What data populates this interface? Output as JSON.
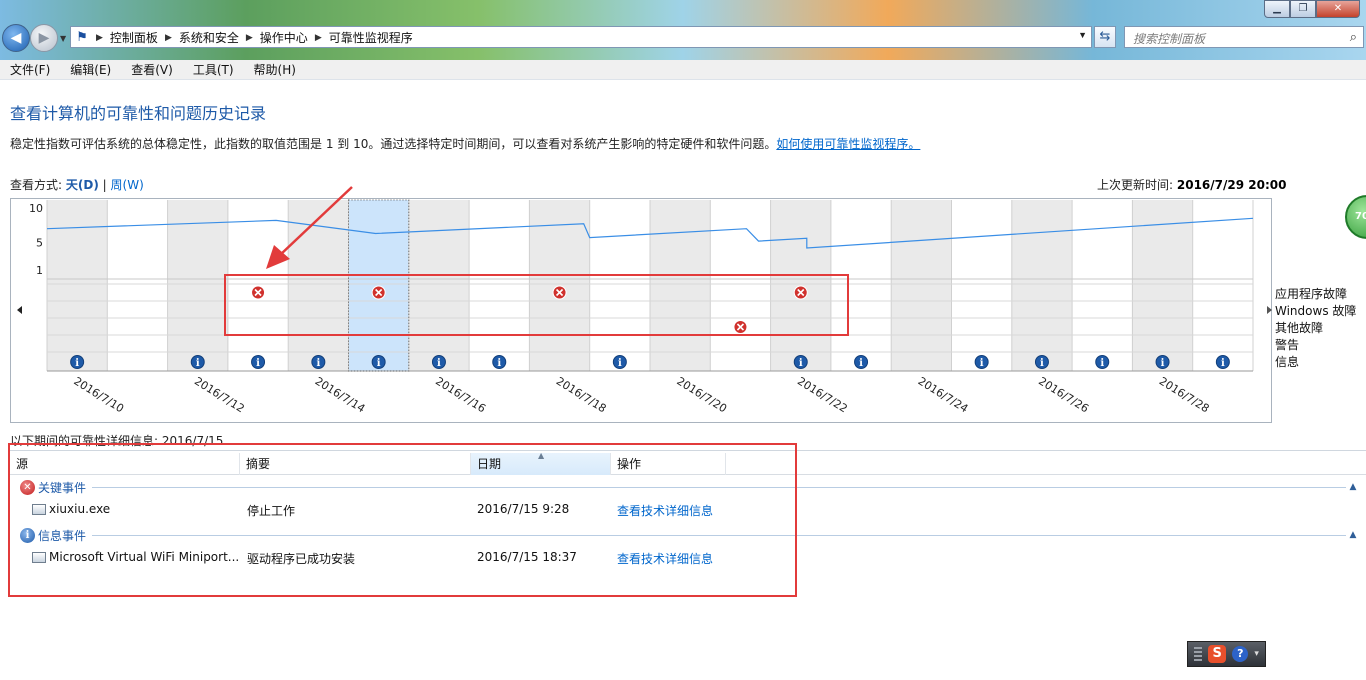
{
  "window": {
    "minimize": "▁",
    "restore": "❐",
    "close": "✕"
  },
  "breadcrumb": [
    "控制面板",
    "系统和安全",
    "操作中心",
    "可靠性监视程序"
  ],
  "search": {
    "placeholder": "搜索控制面板"
  },
  "menu": [
    "文件(F)",
    "编辑(E)",
    "查看(V)",
    "工具(T)",
    "帮助(H)"
  ],
  "page": {
    "title": "查看计算机的可靠性和问题历史记录",
    "description": "稳定性指数可评估系统的总体稳定性，此指数的取值范围是 1 到 10。通过选择特定时间期间，可以查看对系统产生影响的特定硬件和软件问题。",
    "help_link": "如何使用可靠性监视程序。",
    "view_label": "查看方式:",
    "view_day": "天(D)",
    "view_sep": "|",
    "view_week": "周(W)",
    "last_update_label": "上次更新时间:",
    "last_update_value": "2016/7/29 20:00",
    "score_badge": "70"
  },
  "chart_data": {
    "type": "line",
    "y_ticks": [
      "10",
      "5",
      "1"
    ],
    "ylim": [
      1,
      10
    ],
    "columns": [
      "2016/7/10",
      "2016/7/11",
      "2016/7/12",
      "2016/7/13",
      "2016/7/14",
      "2016/7/15",
      "2016/7/16",
      "2016/7/17",
      "2016/7/18",
      "2016/7/19",
      "2016/7/20",
      "2016/7/21",
      "2016/7/22",
      "2016/7/23",
      "2016/7/24",
      "2016/7/25",
      "2016/7/26",
      "2016/7/27",
      "2016/7/28",
      "2016/7/29"
    ],
    "x_tick_labels": [
      "2016/7/10",
      "2016/7/12",
      "2016/7/14",
      "2016/7/16",
      "2016/7/18",
      "2016/7/20",
      "2016/7/22",
      "2016/7/24",
      "2016/7/26",
      "2016/7/28"
    ],
    "selected_column": "2016/7/15",
    "stability_index": [
      {
        "x": 0,
        "y": 7.0
      },
      {
        "x": 3.8,
        "y": 8.2
      },
      {
        "x": 5.45,
        "y": 6.3
      },
      {
        "x": 8.9,
        "y": 7.7
      },
      {
        "x": 9.0,
        "y": 5.7
      },
      {
        "x": 11.6,
        "y": 7.0
      },
      {
        "x": 11.8,
        "y": 5.2
      },
      {
        "x": 12.6,
        "y": 5.6
      },
      {
        "x": 12.6,
        "y": 4.2
      },
      {
        "x": 20,
        "y": 8.5
      }
    ],
    "categories": [
      "应用程序故障",
      "Windows 故障",
      "其他故障",
      "警告",
      "信息"
    ],
    "events": {
      "应用程序故障": [
        "2016/7/13",
        "2016/7/15",
        "2016/7/18",
        "2016/7/22"
      ],
      "Windows 故障": [],
      "其他故障": [
        "2016/7/21"
      ],
      "警告": [],
      "信息": [
        "2016/7/10",
        "2016/7/12",
        "2016/7/13",
        "2016/7/14",
        "2016/7/15",
        "2016/7/16",
        "2016/7/17",
        "2016/7/19",
        "2016/7/22",
        "2016/7/23",
        "2016/7/25",
        "2016/7/26",
        "2016/7/27",
        "2016/7/28",
        "2016/7/29"
      ]
    },
    "colors": {
      "line": "#3a8ee6",
      "selected": "#cce4fb",
      "shaded": "#eaeaea",
      "error": "#d0312d",
      "info": "#1e5aa8"
    }
  },
  "details": {
    "caption": "以下期间的可靠性详细信息: 2016/7/15",
    "columns": [
      "源",
      "摘要",
      "日期",
      "操作"
    ],
    "groups": [
      {
        "title": "关键事件",
        "icon": "error-icon",
        "rows": [
          {
            "source": "xiuxiu.exe",
            "summary": "停止工作",
            "date": "2016/7/15 9:28",
            "action": "查看技术详细信息"
          }
        ]
      },
      {
        "title": "信息事件",
        "icon": "info-icon",
        "rows": [
          {
            "source": "Microsoft Virtual WiFi Miniport...",
            "summary": "驱动程序已成功安装",
            "date": "2016/7/15 18:37",
            "action": "查看技术详细信息"
          }
        ]
      }
    ]
  },
  "ime": {
    "logo": "S",
    "help": "?"
  }
}
